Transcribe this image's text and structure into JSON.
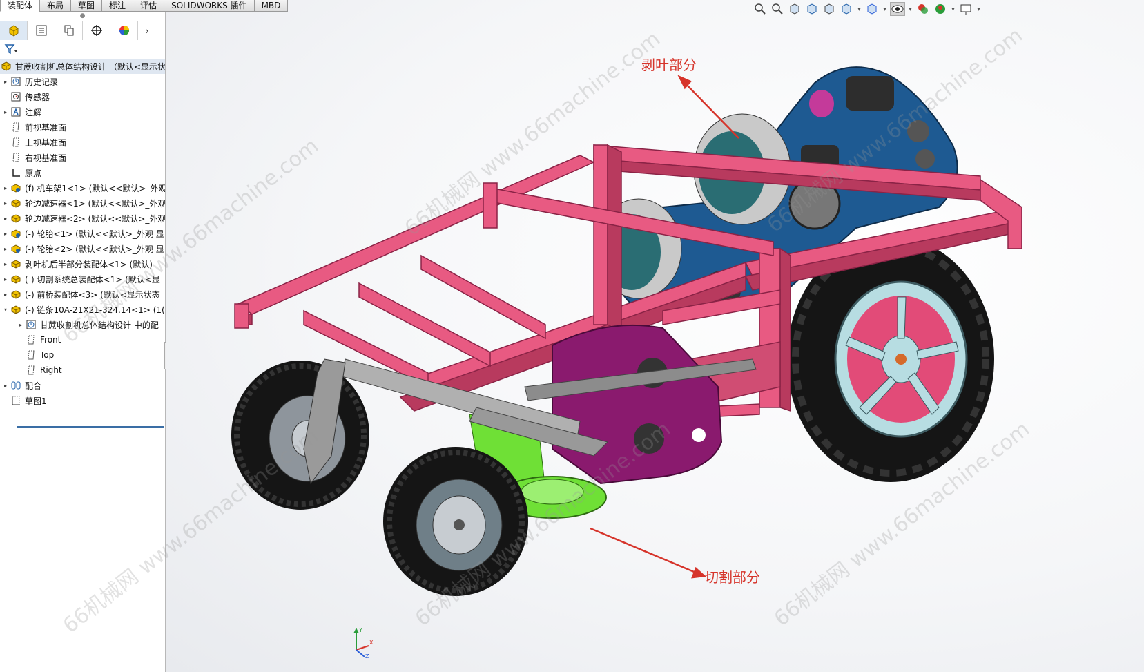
{
  "tabs": [
    {
      "label": "装配体",
      "active": true
    },
    {
      "label": "布局",
      "active": false
    },
    {
      "label": "草图",
      "active": false
    },
    {
      "label": "标注",
      "active": false
    },
    {
      "label": "评估",
      "active": false
    },
    {
      "label": "SOLIDWORKS 插件",
      "active": false
    },
    {
      "label": "MBD",
      "active": false
    }
  ],
  "panel": {
    "tabs": [
      "feature-manager",
      "property-manager",
      "configuration-manager",
      "dimxpert-manager",
      "display-manager"
    ],
    "more": "›",
    "filter_icon": "filter-icon",
    "root": "甘蔗收割机总体结构设计 （默认<显示状",
    "items": [
      {
        "label": "历史记录",
        "icon": "history-icon",
        "expand": "▸",
        "indent": 0
      },
      {
        "label": "传感器",
        "icon": "sensor-icon",
        "expand": "",
        "indent": 0
      },
      {
        "label": "注解",
        "icon": "annotation-icon",
        "expand": "▸",
        "indent": 0
      },
      {
        "label": "前视基准面",
        "icon": "plane-icon",
        "expand": "",
        "indent": 0
      },
      {
        "label": "上视基准面",
        "icon": "plane-icon",
        "expand": "",
        "indent": 0
      },
      {
        "label": "右视基准面",
        "icon": "plane-icon",
        "expand": "",
        "indent": 0
      },
      {
        "label": "原点",
        "icon": "origin-icon",
        "expand": "",
        "indent": 0
      },
      {
        "label": "(f) 机车架1<1> (默认<<默认>_外观",
        "icon": "part-icon",
        "expand": "▸",
        "indent": 0
      },
      {
        "label": "轮边减速器<1> (默认<<默认>_外观",
        "icon": "subassembly-icon",
        "expand": "▸",
        "indent": 0
      },
      {
        "label": "轮边减速器<2> (默认<<默认>_外观",
        "icon": "subassembly-icon",
        "expand": "▸",
        "indent": 0
      },
      {
        "label": "(-) 轮胎<1> (默认<<默认>_外观 显",
        "icon": "part-icon",
        "expand": "▸",
        "indent": 0
      },
      {
        "label": "(-) 轮胎<2> (默认<<默认>_外观 显",
        "icon": "part-icon",
        "expand": "▸",
        "indent": 0
      },
      {
        "label": "剥叶机后半部分装配体<1> (默认)",
        "icon": "subassembly-icon",
        "expand": "▸",
        "indent": 0
      },
      {
        "label": "(-) 切割系统总装配体<1> (默认<显",
        "icon": "subassembly-icon",
        "expand": "▸",
        "indent": 0
      },
      {
        "label": "(-) 前桥装配体<3> (默认<显示状态",
        "icon": "subassembly-icon",
        "expand": "▸",
        "indent": 0
      },
      {
        "label": "(-) 链条10A-21X21-324.14<1> (1(",
        "icon": "subassembly-icon",
        "expand": "▾",
        "indent": 0
      },
      {
        "label": "甘蔗收割机总体结构设计 中的配",
        "icon": "history-icon",
        "expand": "▸",
        "indent": 1
      },
      {
        "label": "Front",
        "icon": "plane-icon",
        "expand": "",
        "indent": 1
      },
      {
        "label": "Top",
        "icon": "plane-icon",
        "expand": "",
        "indent": 1
      },
      {
        "label": "Right",
        "icon": "plane-icon",
        "expand": "",
        "indent": 1
      },
      {
        "label": "配合",
        "icon": "mates-icon",
        "expand": "▸",
        "indent": 0
      },
      {
        "label": "草图1",
        "icon": "sketch-icon",
        "expand": "",
        "indent": 0
      }
    ]
  },
  "heads_up": [
    "zoom-to-fit-icon",
    "zoom-area-icon",
    "previous-view-icon",
    "section-view-icon",
    "dynamic-annotation-icon",
    "view-orientation-icon",
    "display-style-icon",
    "hide-show-icon",
    "edit-appearance-icon",
    "apply-scene-icon",
    "view-settings-icon"
  ],
  "callouts": {
    "peel": "剥叶部分",
    "cut": "切割部分"
  },
  "watermark": "66机械网 www.66machine.com",
  "triad_labels": {
    "x": "X",
    "y": "Y",
    "z": "Z"
  },
  "colors": {
    "frame": "#e85a82",
    "frame_dark": "#b83a5e",
    "blue": "#1e5a92",
    "purple": "#8a1a6e",
    "green": "#6fe036",
    "tire": "#151515",
    "rim": "#b7dde2",
    "callout": "#d6342b",
    "selection": "#dfe7f1"
  }
}
